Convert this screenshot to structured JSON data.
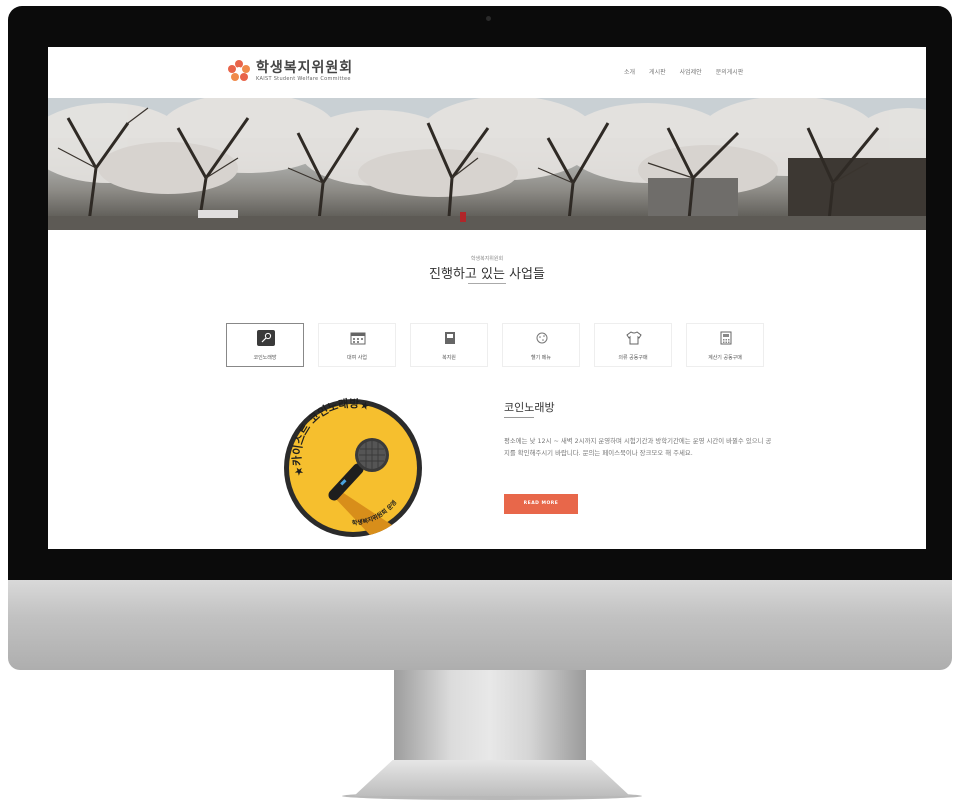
{
  "header": {
    "logo_title": "학생복지위원회",
    "logo_subtitle": "KAIST Student Welfare Committee"
  },
  "nav": [
    "소개",
    "게시판",
    "사업제안",
    "문의게시판"
  ],
  "section": {
    "kicker": "학생복지위원회",
    "title": "진행하고 있는 사업들"
  },
  "tabs": [
    {
      "label": "코인노래방",
      "icon": "microphone-icon",
      "active": true
    },
    {
      "label": "대여 사업",
      "icon": "calendar-icon",
      "active": false
    },
    {
      "label": "복지원",
      "icon": "book-icon",
      "active": false
    },
    {
      "label": "헬기 메뉴",
      "icon": "cookie-icon",
      "active": false
    },
    {
      "label": "의류 공동구매",
      "icon": "shirt-icon",
      "active": false
    },
    {
      "label": "계산기 공동구매",
      "icon": "calculator-icon",
      "active": false
    }
  ],
  "feature": {
    "title": "코인노래방",
    "description": "평소에는 낮 12시 ~ 새벽 2시까지 운영하며 시험기간과 방학기간에는 운영 시간이 바뀔수 있으니 공지를 확인해주시기 바랍니다. 문의는 페이스북이나 장크모오 해 주세요.",
    "button": "READ MORE",
    "badge_top": "★카이스트 코인노래방★",
    "badge_bottom": "학생복지위원회 운영"
  },
  "colors": {
    "accent": "#e8674a",
    "badge_yellow": "#f6bf2e",
    "badge_shadow": "#d88e1a"
  }
}
